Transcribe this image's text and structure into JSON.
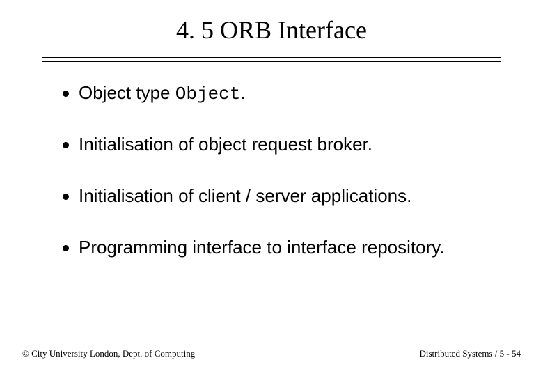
{
  "title": "4. 5 ORB Interface",
  "items": [
    {
      "prefix": "Object type ",
      "mono": "Object",
      "suffix": "."
    },
    {
      "prefix": "Initialisation of object request broker.",
      "mono": "",
      "suffix": ""
    },
    {
      "prefix": "Initialisation of client / server applications.",
      "mono": "",
      "suffix": ""
    },
    {
      "prefix": "Programming interface to interface repository.",
      "mono": "",
      "suffix": ""
    }
  ],
  "footer": {
    "left": "© City University London, Dept. of Computing",
    "right": "Distributed Systems / 5 - 54"
  }
}
